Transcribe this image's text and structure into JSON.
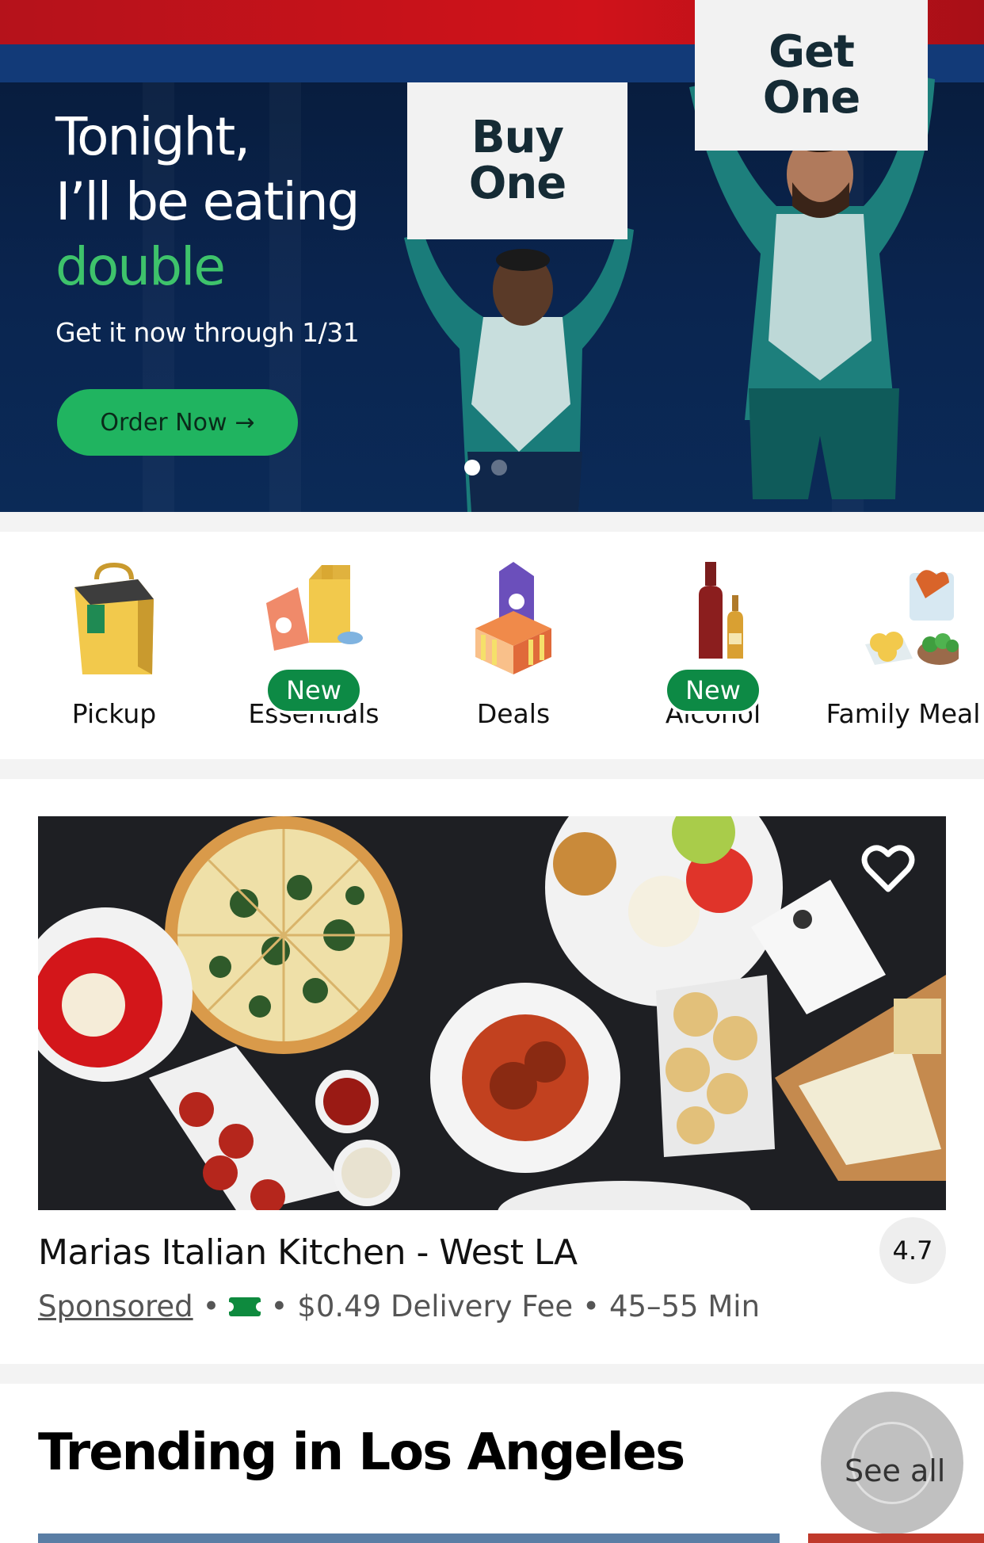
{
  "hero": {
    "line1": "Tonight,",
    "line2": "I’ll be eating",
    "line3": "double",
    "subtitle": "Get it now through 1/31",
    "cta_label": "Order Now",
    "cta_arrow": "→",
    "sign1_line1": "Buy",
    "sign1_line2": "One",
    "sign2_line1": "Get",
    "sign2_line2": "One",
    "carousel_total": 2,
    "carousel_active": 1
  },
  "categories": [
    {
      "label": "Pickup",
      "icon": "shopping-bag-icon",
      "badge": ""
    },
    {
      "label": "Essentials",
      "icon": "essentials-icon",
      "badge": "New"
    },
    {
      "label": "Deals",
      "icon": "deals-tag-icon",
      "badge": ""
    },
    {
      "label": "Alcohol",
      "icon": "wine-bottle-icon",
      "badge": "New"
    },
    {
      "label": "Family Meal",
      "icon": "family-meal-icon",
      "badge": ""
    }
  ],
  "restaurant": {
    "name": "Marias Italian Kitchen - West LA",
    "sponsored": "Sponsored",
    "bullet": "•",
    "delivery_fee": "$0.49 Delivery Fee",
    "eta": "45–55 Min",
    "rating": "4.7"
  },
  "trending": {
    "title": "Trending in Los Angeles",
    "see_all": "See all"
  },
  "colors": {
    "brand_green": "#20b460",
    "badge_green": "#0d8a45",
    "hero_navy": "#0a2550"
  }
}
